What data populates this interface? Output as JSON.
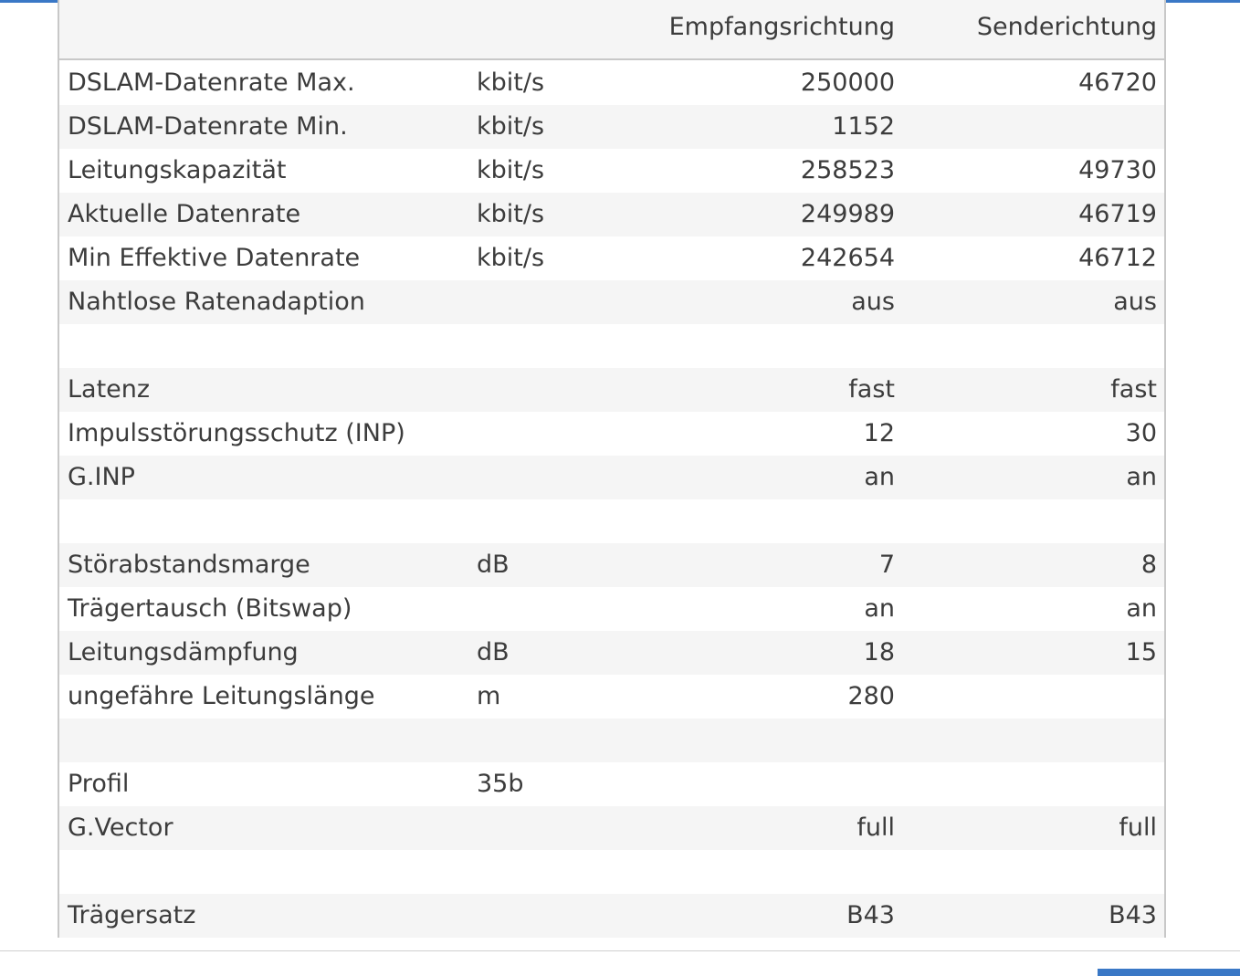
{
  "header": {
    "col_recv": "Empfangsrichtung",
    "col_send": "Senderichtung"
  },
  "rows": [
    {
      "label": "DSLAM-Datenrate Max.",
      "unit": "kbit/s",
      "recv": "250000",
      "send": "46720"
    },
    {
      "label": "DSLAM-Datenrate Min.",
      "unit": "kbit/s",
      "recv": "1152",
      "send": ""
    },
    {
      "label": "Leitungskapazität",
      "unit": "kbit/s",
      "recv": "258523",
      "send": "49730"
    },
    {
      "label": "Aktuelle Datenrate",
      "unit": "kbit/s",
      "recv": "249989",
      "send": "46719"
    },
    {
      "label": "Min Effektive Datenrate",
      "unit": "kbit/s",
      "recv": "242654",
      "send": "46712"
    },
    {
      "label": "Nahtlose Ratenadaption",
      "unit": "",
      "recv": "aus",
      "send": "aus"
    },
    {
      "label": "",
      "unit": "",
      "recv": "",
      "send": ""
    },
    {
      "label": "Latenz",
      "unit": "",
      "recv": "fast",
      "send": "fast"
    },
    {
      "label": "Impulsstörungsschutz (INP)",
      "unit": "",
      "recv": "12",
      "send": "30"
    },
    {
      "label": "G.INP",
      "unit": "",
      "recv": "an",
      "send": "an"
    },
    {
      "label": "",
      "unit": "",
      "recv": "",
      "send": ""
    },
    {
      "label": "Störabstandsmarge",
      "unit": "dB",
      "recv": "7",
      "send": "8"
    },
    {
      "label": "Trägertausch (Bitswap)",
      "unit": "",
      "recv": "an",
      "send": "an"
    },
    {
      "label": "Leitungsdämpfung",
      "unit": "dB",
      "recv": "18",
      "send": "15"
    },
    {
      "label": "ungefähre Leitungslänge",
      "unit": "m",
      "recv": "280",
      "send": ""
    },
    {
      "label": "",
      "unit": "",
      "recv": "",
      "send": ""
    },
    {
      "label": "Profil",
      "unit": "35b",
      "recv": "",
      "send": ""
    },
    {
      "label": "G.Vector",
      "unit": "",
      "recv": "full",
      "send": "full"
    },
    {
      "label": "",
      "unit": "",
      "recv": "",
      "send": ""
    },
    {
      "label": "Trägersatz",
      "unit": "",
      "recv": "B43",
      "send": "B43"
    }
  ]
}
